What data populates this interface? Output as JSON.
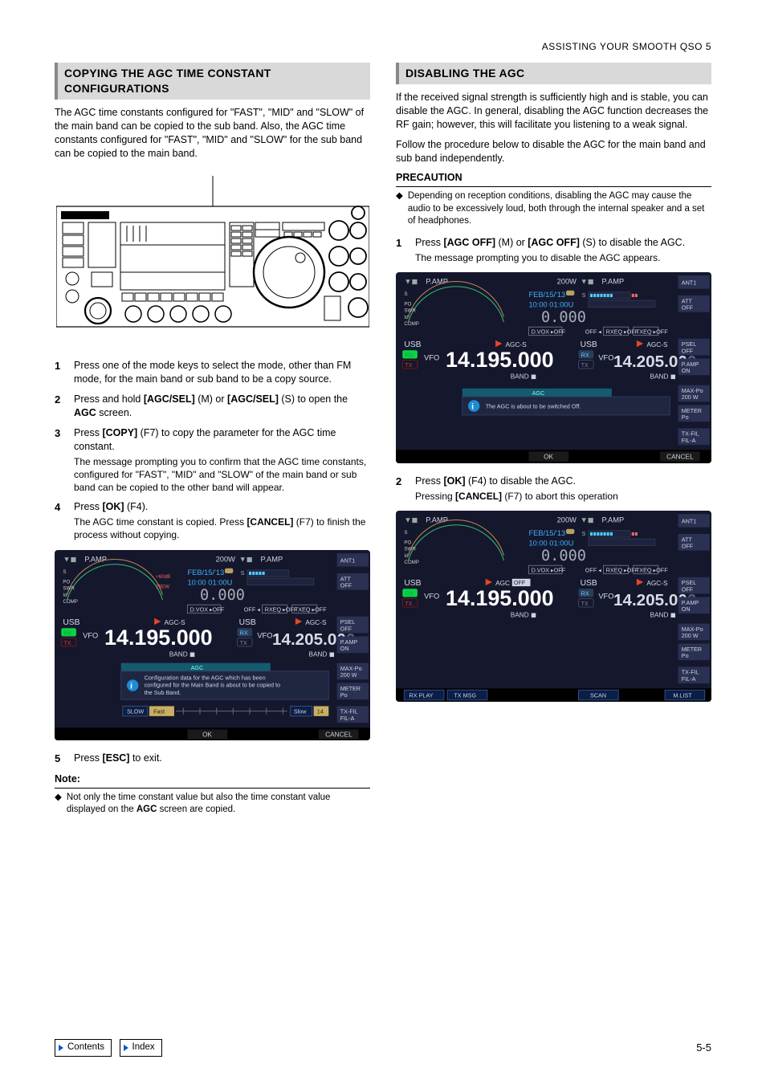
{
  "running_head": "ASSISTING YOUR SMOOTH QSO 5",
  "left": {
    "title": "COPYING THE AGC TIME CONSTANT CONFIGURATIONS",
    "intro": "The AGC time constants configured for \"FAST\", \"MID\" and \"SLOW\" of the main band can be copied to the sub band. Also, the AGC time constants configured for \"FAST\", \"MID\" and \"SLOW\" for the sub band can be copied to the main band.",
    "steps": [
      {
        "n": "1",
        "text": "Press one of the mode keys to select the mode, other than FM mode, for the main band or sub band to be a copy source."
      },
      {
        "n": "2",
        "text": "Press and hold [AGC/SEL] (M) or [AGC/SEL] (S) to open the AGC screen."
      },
      {
        "n": "3",
        "text": "Press [COPY] (F7) to copy the parameter for the AGC time constant.",
        "sub": "The message prompting you to confirm that the AGC time constants, configured for \"FAST\", \"MID\" and \"SLOW\" of the main band or sub band can be copied to the other band will appear."
      },
      {
        "n": "4",
        "text": "Press [OK] (F4).",
        "sub": "The AGC time constant is copied. Press [CANCEL] (F7) to finish the process without copying."
      },
      {
        "n": "5",
        "text": "Press [ESC] to exit."
      }
    ],
    "note_head": "Note:",
    "note_item": "Not only the time constant value but also the time constant value displayed on the AGC screen are copied."
  },
  "right": {
    "title": "DISABLING THE AGC",
    "intro1": "If the received signal strength is sufficiently high and is stable, you can disable the AGC. In general, disabling the AGC function decreases the RF gain; however, this will facilitate you listening to a weak signal.",
    "intro2": "Follow the procedure below to disable the AGC for the main band and sub band independently.",
    "precaution_head": "PRECAUTION",
    "precaution_item": "Depending on reception conditions, disabling the AGC may cause the audio to be excessively loud, both through the internal speaker and a set of headphones.",
    "steps": [
      {
        "n": "1",
        "text": "Press [AGC OFF] (M) or [AGC OFF] (S) to disable the AGC.",
        "sub": "The message prompting you to disable the AGC appears."
      },
      {
        "n": "2",
        "text": "Press [OK] (F4) to disable the AGC.",
        "sub": "Pressing [CANCEL] (F7) to abort this operation"
      }
    ]
  },
  "lcd_common": {
    "p_amp": "P.AMP",
    "power": "200W",
    "date": "FEB/15/'13",
    "time": "10:00 01:00U",
    "zero": "0.000",
    "dvox": "D.VOX",
    "off": "OFF",
    "rxeq": "RXEQ",
    "txeq": "TXEQ",
    "usb": "USB",
    "vfo": "VFO",
    "agc_s": "AGC-S",
    "agc_off": "AGC OFF",
    "rx": "RX",
    "tx": "TX",
    "band": "BAND",
    "freq_m": "14.195.000",
    "freq_s": "14.205.000",
    "side": [
      "ANT1",
      "ATT\nOFF",
      "PSEL\nOFF",
      "P.AMP\nON",
      "MAX-Po\n200 W",
      "METER\nPo",
      "TX-FIL\nFIL-A"
    ],
    "ok": "OK",
    "cancel": "CANCEL"
  },
  "lcd1": {
    "banner": "AGC",
    "msg": "Configuration data for the AGC which has been configured for the Main Band is about to be copied to the Sub Band.",
    "slow": "SLOW",
    "fast": "Fast",
    "slow2": "Slow",
    "val": "14"
  },
  "lcd2": {
    "banner": "AGC",
    "msg": "The AGC is about to be switched Off."
  },
  "lcd3": {
    "btns": [
      "RX PLAY",
      "TX MSG",
      "",
      "",
      "SCAN",
      "",
      "M.LIST"
    ]
  },
  "footer": {
    "contents": "Contents",
    "index": "Index",
    "page": "5-5"
  }
}
